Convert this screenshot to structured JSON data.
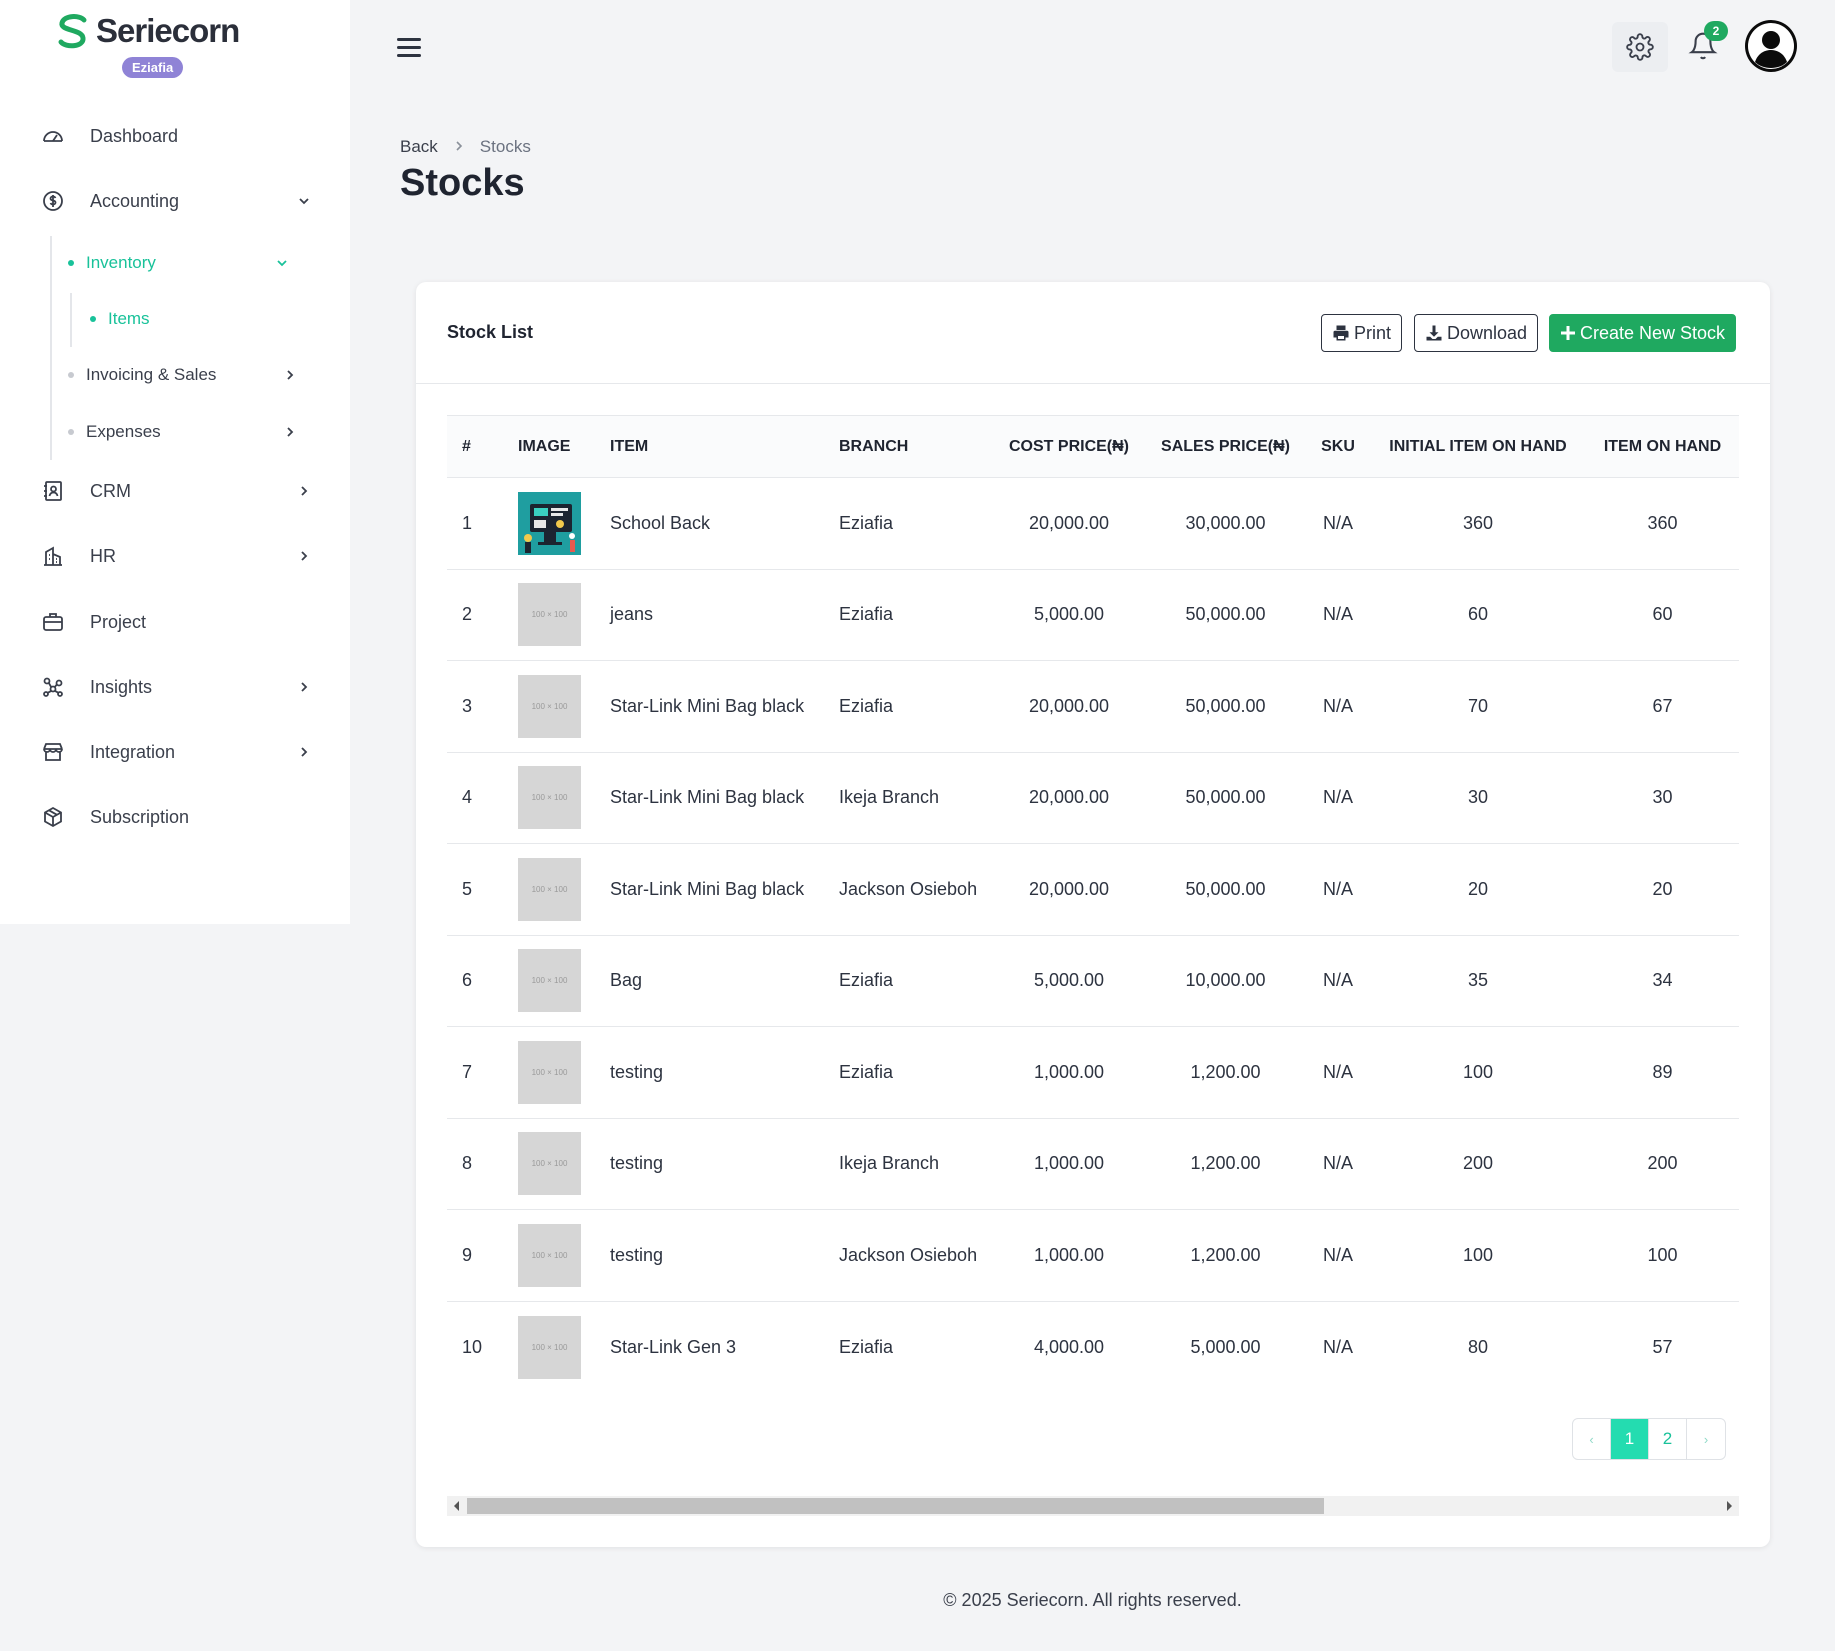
{
  "brand": {
    "name": "Seriecorn",
    "badge": "Eziafia"
  },
  "sidebar": {
    "dashboard": "Dashboard",
    "accounting": "Accounting",
    "inventory": "Inventory",
    "items": "Items",
    "invoicing": "Invoicing & Sales",
    "expenses": "Expenses",
    "crm": "CRM",
    "hr": "HR",
    "project": "Project",
    "insights": "Insights",
    "integration": "Integration",
    "subscription": "Subscription"
  },
  "topbar": {
    "notification_count": "2"
  },
  "breadcrumb": {
    "back": "Back",
    "current": "Stocks"
  },
  "page": {
    "title": "Stocks"
  },
  "card": {
    "title": "Stock List",
    "print_label": "Print",
    "download_label": "Download",
    "create_label": "Create New Stock"
  },
  "table": {
    "headers": [
      "#",
      "IMAGE",
      "ITEM",
      "BRANCH",
      "COST PRICE(₦)",
      "SALES PRICE(₦)",
      "SKU",
      "INITIAL ITEM ON HAND",
      "ITEM ON HAND"
    ],
    "placeholder_text": "100 × 100",
    "rows": [
      {
        "n": "1",
        "item": "School Back",
        "branch": "Eziafia",
        "cost": "20,000.00",
        "sales": "30,000.00",
        "sku": "N/A",
        "initial": "360",
        "on_hand": "360"
      },
      {
        "n": "2",
        "item": "jeans",
        "branch": "Eziafia",
        "cost": "5,000.00",
        "sales": "50,000.00",
        "sku": "N/A",
        "initial": "60",
        "on_hand": "60"
      },
      {
        "n": "3",
        "item": "Star-Link Mini Bag black",
        "branch": "Eziafia",
        "cost": "20,000.00",
        "sales": "50,000.00",
        "sku": "N/A",
        "initial": "70",
        "on_hand": "67"
      },
      {
        "n": "4",
        "item": "Star-Link Mini Bag black",
        "branch": "Ikeja Branch",
        "cost": "20,000.00",
        "sales": "50,000.00",
        "sku": "N/A",
        "initial": "30",
        "on_hand": "30"
      },
      {
        "n": "5",
        "item": "Star-Link Mini Bag black",
        "branch": "Jackson Osieboh",
        "cost": "20,000.00",
        "sales": "50,000.00",
        "sku": "N/A",
        "initial": "20",
        "on_hand": "20"
      },
      {
        "n": "6",
        "item": "Bag",
        "branch": "Eziafia",
        "cost": "5,000.00",
        "sales": "10,000.00",
        "sku": "N/A",
        "initial": "35",
        "on_hand": "34"
      },
      {
        "n": "7",
        "item": "testing",
        "branch": "Eziafia",
        "cost": "1,000.00",
        "sales": "1,200.00",
        "sku": "N/A",
        "initial": "100",
        "on_hand": "89"
      },
      {
        "n": "8",
        "item": "testing",
        "branch": "Ikeja Branch",
        "cost": "1,000.00",
        "sales": "1,200.00",
        "sku": "N/A",
        "initial": "200",
        "on_hand": "200"
      },
      {
        "n": "9",
        "item": "testing",
        "branch": "Jackson Osieboh",
        "cost": "1,000.00",
        "sales": "1,200.00",
        "sku": "N/A",
        "initial": "100",
        "on_hand": "100"
      },
      {
        "n": "10",
        "item": "Star-Link Gen 3",
        "branch": "Eziafia",
        "cost": "4,000.00",
        "sales": "5,000.00",
        "sku": "N/A",
        "initial": "80",
        "on_hand": "57"
      }
    ]
  },
  "pagination": {
    "prev": "‹",
    "pages": [
      "1",
      "2"
    ],
    "next": "›",
    "current": "1"
  },
  "footer": {
    "text": "© 2025 Seriecorn. All rights reserved."
  },
  "colors": {
    "accent": "#19c29a",
    "primary_button": "#1fa960",
    "badge": "#8f83d6"
  }
}
